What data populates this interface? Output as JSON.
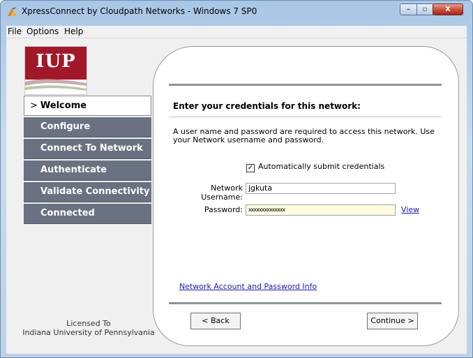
{
  "window": {
    "title": "XpressConnect by Cloudpath Networks - Windows 7 SP0",
    "minimize_glyph": "–",
    "maximize_glyph": "▫",
    "close_glyph": "X"
  },
  "menu": [
    "File",
    "Options",
    "Help"
  ],
  "logo": {
    "text": "IUP"
  },
  "nav": {
    "arrow": ">",
    "items": [
      {
        "label": "Welcome",
        "active": true
      },
      {
        "label": "Configure",
        "active": false
      },
      {
        "label": "Connect To Network",
        "active": false
      },
      {
        "label": "Authenticate",
        "active": false
      },
      {
        "label": "Validate Connectivity",
        "active": false
      },
      {
        "label": "Connected",
        "active": false
      }
    ]
  },
  "license": {
    "line1": "Licensed To",
    "line2": "Indiana University of Pennsylvania"
  },
  "main": {
    "heading": "Enter your credentials for this network:",
    "description": "A user name and password are required to access this network.  Use your Network username and password.",
    "auto_submit": {
      "label": "Automatically submit credentials",
      "checked": true,
      "check_glyph": "✓"
    },
    "username": {
      "label": "Network Username:",
      "value": "jgkuta"
    },
    "password": {
      "label": "Password:",
      "value": "xxxxxxxxxxxxxx",
      "show_link": "View"
    },
    "info_link": "Network Account and Password Info",
    "back_button": "< Back",
    "continue_button": "Continue >"
  },
  "colors": {
    "nav_bg": "#6a7281",
    "brand_red": "#a0182a",
    "link": "#1a1aa6",
    "password_bg": "#fefbe0"
  }
}
